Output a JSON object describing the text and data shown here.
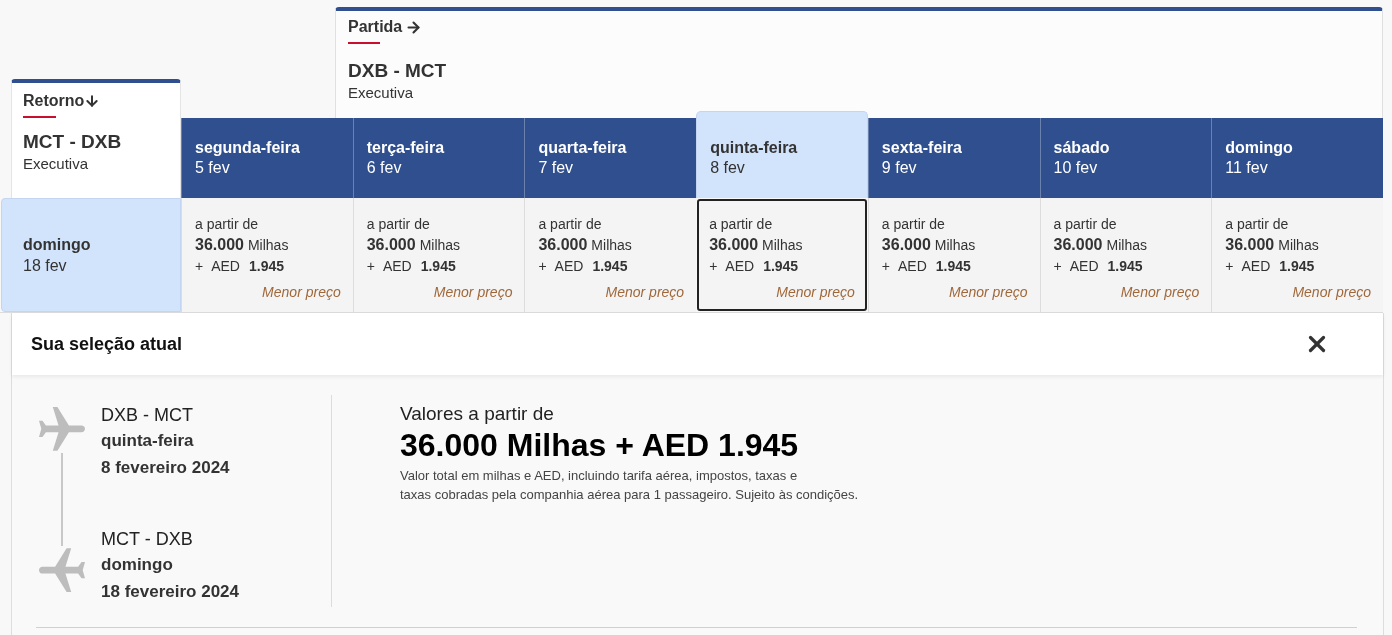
{
  "outbound": {
    "label": "Partida",
    "route": "DXB - MCT",
    "cabin": "Executiva"
  },
  "return": {
    "label": "Retorno",
    "route": "MCT - DXB",
    "cabin": "Executiva",
    "dates": [
      {
        "weekday": "domingo",
        "date": "18 fev",
        "selected": true
      }
    ]
  },
  "outbound_dates": [
    {
      "weekday": "segunda-feira",
      "date": "5 fev",
      "selected": false,
      "fare": {
        "prefix": "a partir de",
        "miles": "36.000",
        "miles_unit": "Milhas",
        "plus": "+",
        "currency": "AED",
        "amount": "1.945",
        "note": "Menor preço"
      }
    },
    {
      "weekday": "terça-feira",
      "date": "6 fev",
      "selected": false,
      "fare": {
        "prefix": "a partir de",
        "miles": "36.000",
        "miles_unit": "Milhas",
        "plus": "+",
        "currency": "AED",
        "amount": "1.945",
        "note": "Menor preço"
      }
    },
    {
      "weekday": "quarta-feira",
      "date": "7 fev",
      "selected": false,
      "fare": {
        "prefix": "a partir de",
        "miles": "36.000",
        "miles_unit": "Milhas",
        "plus": "+",
        "currency": "AED",
        "amount": "1.945",
        "note": "Menor preço"
      }
    },
    {
      "weekday": "quinta-feira",
      "date": "8 fev",
      "selected": true,
      "fare": {
        "prefix": "a partir de",
        "miles": "36.000",
        "miles_unit": "Milhas",
        "plus": "+",
        "currency": "AED",
        "amount": "1.945",
        "note": "Menor preço"
      }
    },
    {
      "weekday": "sexta-feira",
      "date": "9 fev",
      "selected": false,
      "fare": {
        "prefix": "a partir de",
        "miles": "36.000",
        "miles_unit": "Milhas",
        "plus": "+",
        "currency": "AED",
        "amount": "1.945",
        "note": "Menor preço"
      }
    },
    {
      "weekday": "sábado",
      "date": "10 fev",
      "selected": false,
      "fare": {
        "prefix": "a partir de",
        "miles": "36.000",
        "miles_unit": "Milhas",
        "plus": "+",
        "currency": "AED",
        "amount": "1.945",
        "note": "Menor preço"
      }
    },
    {
      "weekday": "domingo",
      "date": "11 fev",
      "selected": false,
      "fare": {
        "prefix": "a partir de",
        "miles": "36.000",
        "miles_unit": "Milhas",
        "plus": "+",
        "currency": "AED",
        "amount": "1.945",
        "note": "Menor preço"
      }
    }
  ],
  "selection": {
    "title": "Sua seleção atual",
    "flights": [
      {
        "route": "DXB - MCT",
        "weekday": "quinta-feira",
        "date": "8 fevereiro 2024"
      },
      {
        "route": "MCT - DXB",
        "weekday": "domingo",
        "date": "18 fevereiro 2024"
      }
    ],
    "price_label": "Valores a partir de",
    "price_total": "36.000 Milhas + AED 1.945",
    "disclaimer": "Valor total em milhas e AED, incluindo tarifa aérea, impostos, taxas e\ntaxas cobradas pela companhia aérea para 1 passageiro. Sujeito às condições."
  }
}
